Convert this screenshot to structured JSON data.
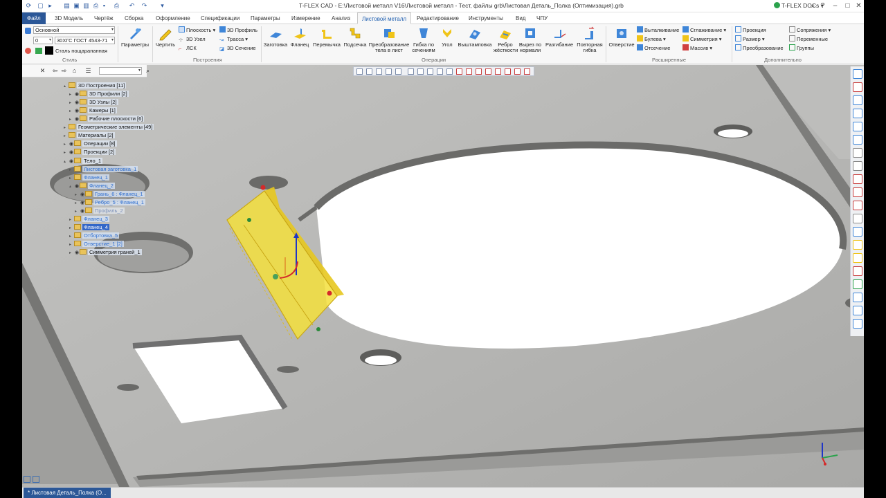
{
  "title_bar": {
    "title": "T-FLEX CAD - E:\\Листовой металл V16\\Листовой металл - Тест, файлы grb\\Листовая Деталь_Полка (Оптимизация).grb",
    "docs_label": "T-FLEX DOCs"
  },
  "menu": {
    "tabs": [
      "Файл",
      "3D Модель",
      "Чертёж",
      "Сборка",
      "Оформление",
      "Спецификации",
      "Параметры",
      "Измерение",
      "Анализ",
      "Листовой металл",
      "Редактирование",
      "Инструменты",
      "Вид",
      "ЧПУ"
    ],
    "active_tab": "Листовой металл"
  },
  "ribbon": {
    "style_group": {
      "label": "Стиль",
      "layer": "Основной",
      "number": "0",
      "standard": "30ХГС ГОСТ 4543-71",
      "material": "Сталь пощарапанная"
    },
    "params_button": "Параметры",
    "draw_button": "Чертить",
    "build_group": {
      "label": "Построения",
      "plane": "Плоскость",
      "node": "3D Узел",
      "lsk": "ЛСК",
      "profile": "3D Профиль",
      "path": "Трасса",
      "section": "3D Сечение"
    },
    "operations_group": {
      "label": "Операции",
      "buttons": [
        "Заготовка",
        "Фланец",
        "Перемычка",
        "Подсечка",
        "Преобразование тела в лист",
        "Гибка по сечениям",
        "Угол",
        "Выштамповка",
        "Ребро жёсткости",
        "Вырез по нормали",
        "Разгибание",
        "Повторная гибка"
      ]
    },
    "extended_group": {
      "label": "Расширенные",
      "hole": "Отверстие",
      "extrude": "Выталкивание",
      "boolean": "Булева",
      "cut": "Отсечение",
      "smooth": "Сглаживание",
      "symmetry": "Симметрия",
      "array": "Массив"
    },
    "additional_group": {
      "label": "Дополнительно",
      "projection": "Проекция",
      "size": "Размер",
      "transform": "Преобразование",
      "mates": "Сопряжения",
      "variables": "Переменные",
      "groups": "Группы"
    }
  },
  "tree": {
    "items": [
      {
        "label": "3D Построения [11]",
        "style": "hl"
      },
      {
        "label": "3D Профили [2]",
        "style": "hl"
      },
      {
        "label": "3D Узлы [2]",
        "style": "hl"
      },
      {
        "label": "Камеры [1]",
        "style": "hl"
      },
      {
        "label": "Рабочие плоскости [6]",
        "style": "hl"
      },
      {
        "label": "Геометрические элементы [49]",
        "style": "hl"
      },
      {
        "label": "Материалы [2]",
        "style": "hl"
      },
      {
        "label": "Операции [8]",
        "style": "hl"
      },
      {
        "label": "Проекции [2]",
        "style": "hl"
      },
      {
        "label": "Тело_1",
        "style": "hl"
      },
      {
        "label": "Листовая заготовка_1",
        "style": "blue"
      },
      {
        "label": "Фланец_1",
        "style": "blue"
      },
      {
        "label": "Фланец_2",
        "style": "blue"
      },
      {
        "label": "Грань_6 : Фланец_1",
        "style": "blue"
      },
      {
        "label": "Ребро_5 : Фланец_1",
        "style": "blue"
      },
      {
        "label": "Профиль_2",
        "style": "faded"
      },
      {
        "label": "Фланец_3",
        "style": "blue"
      },
      {
        "label": "Фланец_4",
        "style": "sel"
      },
      {
        "label": "Отбортовка_5",
        "style": "blue"
      },
      {
        "label": "Отверстие_1 [2]",
        "style": "blue"
      },
      {
        "label": "Симметрия граней_1",
        "style": "hl"
      }
    ]
  },
  "status": {
    "doc_tab": "* Листовая Деталь_Полка (О..."
  },
  "colors": {
    "accent": "#2b5797",
    "selection_fill": "#f3df3c",
    "model_surface": "#b9b9b7"
  }
}
